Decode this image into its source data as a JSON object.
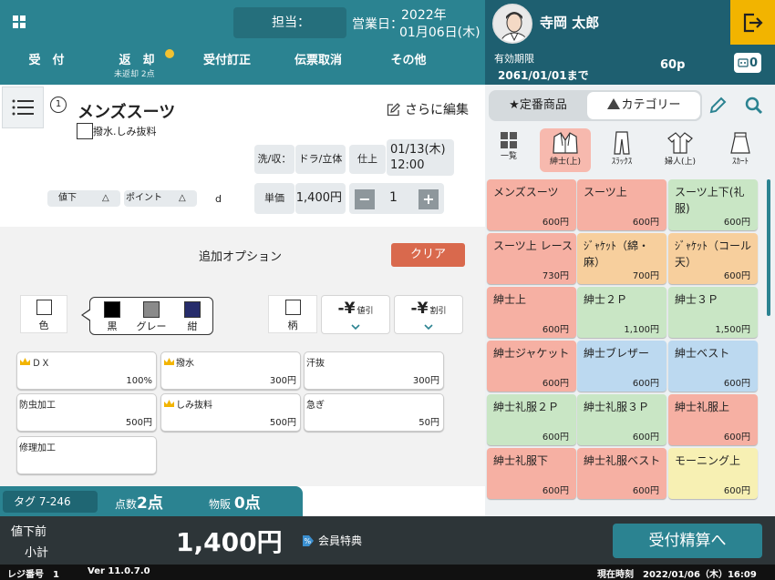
{
  "header": {
    "staff_label": "担当：",
    "bizdate_label": "営業日：",
    "bizdate_year": "2022年",
    "bizdate_day": "01月06日(木)",
    "tabs": [
      {
        "label": "受　付"
      },
      {
        "label": "返　却",
        "sub": "未返却 2点"
      },
      {
        "label": "受付訂正"
      },
      {
        "label": "伝票取消"
      },
      {
        "label": "その他"
      }
    ]
  },
  "user": {
    "name": "寺岡 太郎",
    "expiry_label": "有効期限",
    "expiry_date": "2061/01/01まで",
    "points": "60p",
    "coupons": "0"
  },
  "item": {
    "number": "1",
    "name": "メンズスーツ",
    "edit_more": "さらに編集",
    "water_label": "撥水.しみ抜料",
    "wash_label": "洗/収：",
    "wash_value": "ドラ/立体",
    "finish_label": "仕上日：",
    "finish_date": "01/13(木)",
    "finish_time": "12:00",
    "markdown_label": "値下",
    "markdown_symbol": "△",
    "point_label": "ポイント",
    "point_symbol": "△",
    "d_label": "d",
    "unit_label": "単価",
    "unit_value": "1,400円",
    "qty_minus": "−",
    "qty_plus": "+",
    "quantity": "1"
  },
  "options": {
    "title": "追加オプション",
    "clear": "クリア",
    "color_label": "色",
    "colors": [
      {
        "name": "黒",
        "hex": "#000000"
      },
      {
        "name": "グレー",
        "hex": "#8a8a8a"
      },
      {
        "name": "紺",
        "hex": "#262c6b"
      }
    ],
    "pattern_label": "柄",
    "discount_yen": "-¥",
    "discount_label": "値引",
    "discount2_yen": "-¥",
    "discount2_label": "割引",
    "items": [
      {
        "name": "ＤＸ",
        "price": "100%",
        "crown": true
      },
      {
        "name": "撥水",
        "price": "300円",
        "crown": true
      },
      {
        "name": "汗抜",
        "price": "300円",
        "crown": false
      },
      {
        "name": "防虫加工",
        "price": "500円",
        "crown": false
      },
      {
        "name": "しみ抜料",
        "price": "500円",
        "crown": true
      },
      {
        "name": "急ぎ",
        "price": "50円",
        "crown": false
      },
      {
        "name": "修理加工",
        "price": "",
        "crown": false
      }
    ]
  },
  "tagbar": {
    "tag": "タグ  7-246",
    "count_label": "点数",
    "count_value": "2点",
    "goods_label": "物販",
    "goods_value": "0点"
  },
  "catalog": {
    "seg_fixed": "定番商品",
    "seg_category": "カテゴリー",
    "categories": [
      {
        "label": "一覧",
        "icon": "grid-icon"
      },
      {
        "label": "紳士(上)",
        "icon": "jacket-icon"
      },
      {
        "label": "ｽﾗｯｸｽ",
        "icon": "pants-icon"
      },
      {
        "label": "婦人(上)",
        "icon": "blouse-icon"
      },
      {
        "label": "ｽｶｰﾄ",
        "icon": "skirt-icon"
      }
    ],
    "items": [
      {
        "name": "メンズスーツ",
        "price": "600円",
        "color": "#f6b0a3"
      },
      {
        "name": "スーツ上",
        "price": "600円",
        "color": "#f6b0a3"
      },
      {
        "name": "スーツ上下(礼服)",
        "price": "600円",
        "color": "#c9e6c5"
      },
      {
        "name": "スーツ上 レース",
        "price": "730円",
        "color": "#f6b0a3"
      },
      {
        "name": "ｼﾞｬｹｯﾄ（綿・麻）",
        "price": "700円",
        "color": "#f7cf9d"
      },
      {
        "name": "ｼﾞｬｹｯﾄ（コール天）",
        "price": "600円",
        "color": "#f7cf9d"
      },
      {
        "name": "紳士上",
        "price": "600円",
        "color": "#f6b0a3"
      },
      {
        "name": "紳士２Ｐ",
        "price": "1,100円",
        "color": "#c9e6c5"
      },
      {
        "name": "紳士３Ｐ",
        "price": "1,500円",
        "color": "#c9e6c5"
      },
      {
        "name": "紳士ジャケット",
        "price": "600円",
        "color": "#f6b0a3"
      },
      {
        "name": "紳士ブレザー",
        "price": "600円",
        "color": "#bcd9f0"
      },
      {
        "name": "紳士ベスト",
        "price": "600円",
        "color": "#bcd9f0"
      },
      {
        "name": "紳士礼服２Ｐ",
        "price": "600円",
        "color": "#c9e6c5"
      },
      {
        "name": "紳士礼服３Ｐ",
        "price": "600円",
        "color": "#c9e6c5"
      },
      {
        "name": "紳士礼服上",
        "price": "600円",
        "color": "#f6b0a3"
      },
      {
        "name": "紳士礼服下",
        "price": "600円",
        "color": "#f6b0a3"
      },
      {
        "name": "紳士礼服ベスト",
        "price": "600円",
        "color": "#f6b0a3"
      },
      {
        "name": "モーニング上",
        "price": "600円",
        "color": "#f7f0b3"
      }
    ]
  },
  "footer": {
    "subtotal_line1": "値下前",
    "subtotal_line2": "小計",
    "subtotal_amount": "1,400円",
    "member_benefit": "会員特典",
    "checkout": "受付精算へ",
    "register_no": "レジ番号　1",
    "version": "Ver 11.0.7.0",
    "current_time": "現在時刻　2022/01/06（木）16:09"
  },
  "colors": {
    "header": "#2b8391",
    "user_header": "#1e5f70",
    "logout": "#f2b400",
    "clear": "#d9694d",
    "bottom": "#2d3538"
  }
}
